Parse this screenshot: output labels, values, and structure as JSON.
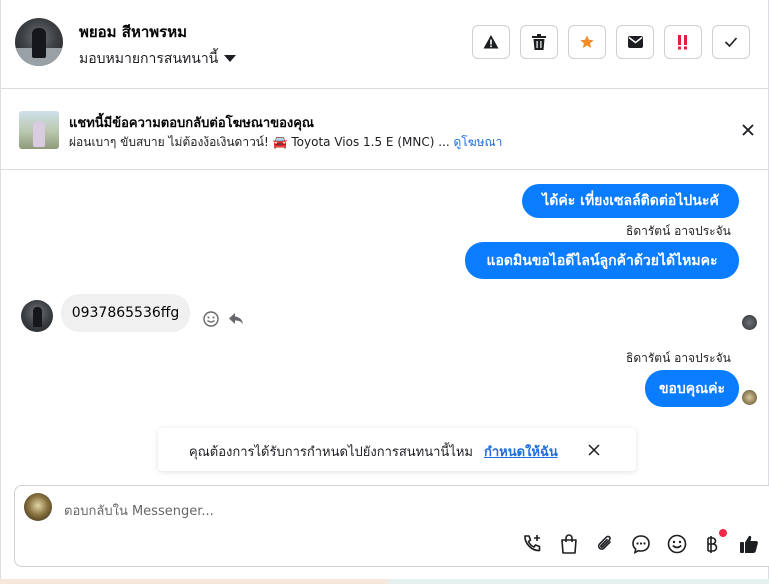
{
  "header": {
    "contact_name": "พยอม สีหาพรหม",
    "assign_label": "มอบหมายการสนทนานี้"
  },
  "ad_banner": {
    "title": "แชทนี้มีข้อความตอบกลับต่อโฆษณาของคุณ",
    "subtitle": "ผ่อนเบาๆ ขับสบาย ไม่ต้องง้อเงินดาวน์! 🚘 Toyota Vios 1.5 E (MNC) ... ",
    "link": "ดูโฆษณา"
  },
  "messages": [
    {
      "direction": "out",
      "text": "ได้ค่ะ เที่ยงเซลล์ติดต่อไปนะคั"
    },
    {
      "direction": "out",
      "sender": "ธิดารัตน์ อาจประจัน",
      "text": "แอดมินขอไอดีไลน์ลูกค้าด้วยได้ไหมคะ"
    },
    {
      "direction": "in",
      "text": "0937865536ffg"
    },
    {
      "direction": "out",
      "sender": "ธิดารัตน์ อาจประจัน",
      "text": "ขอบคุณค่ะ"
    }
  ],
  "suggestion": {
    "text": "คุณต้องการได้รับการกำหนดไปยังการสนทนานี้ไหม",
    "link": "กำหนดให้ฉัน"
  },
  "composer": {
    "placeholder": "ตอบกลับใน Messenger..."
  },
  "colors": {
    "accent": "#0a7cff",
    "link": "#216fdb",
    "star": "#f28c28",
    "alert_red": "#e41e3f"
  }
}
